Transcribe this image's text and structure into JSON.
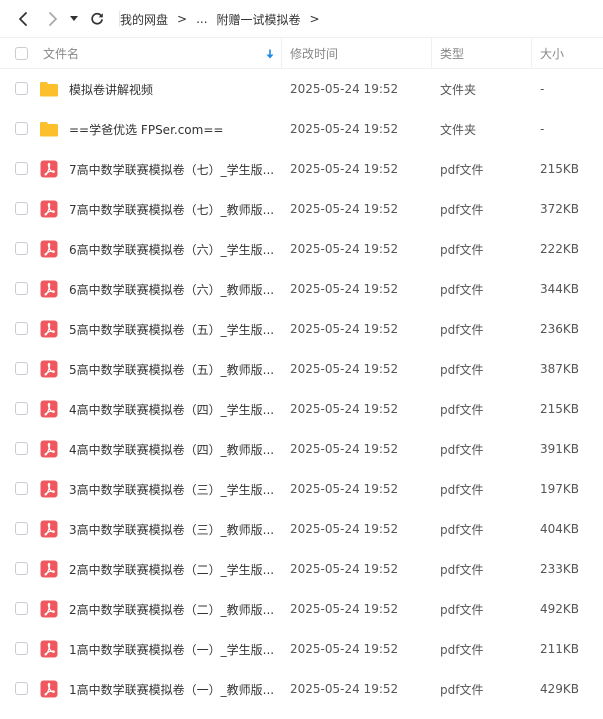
{
  "breadcrumb": {
    "root": "我的网盘",
    "sep1": ">",
    "ellipsis": "...",
    "current": "附赠一试模拟卷",
    "sep2": ">"
  },
  "columns": {
    "name": "文件名",
    "modified": "修改时间",
    "type": "类型",
    "size": "大小"
  },
  "sort_icon": "arrow-down-icon",
  "colors": {
    "folder": "#FBC02D",
    "pdf": "#F0585F",
    "sort_arrow": "#1E88E5"
  },
  "files": [
    {
      "name": "模拟卷讲解视频",
      "modified": "2025-05-24 19:52",
      "type": "文件夹",
      "size": "-",
      "icon": "folder-icon"
    },
    {
      "name": "==学爸优选 FPSer.com==",
      "modified": "2025-05-24 19:52",
      "type": "文件夹",
      "size": "-",
      "icon": "folder-icon"
    },
    {
      "name": "7高中数学联赛模拟卷（七）_学生版...",
      "modified": "2025-05-24 19:52",
      "type": "pdf文件",
      "size": "215KB",
      "icon": "pdf-icon"
    },
    {
      "name": "7高中数学联赛模拟卷（七）_教师版...",
      "modified": "2025-05-24 19:52",
      "type": "pdf文件",
      "size": "372KB",
      "icon": "pdf-icon"
    },
    {
      "name": "6高中数学联赛模拟卷（六）_学生版...",
      "modified": "2025-05-24 19:52",
      "type": "pdf文件",
      "size": "222KB",
      "icon": "pdf-icon"
    },
    {
      "name": "6高中数学联赛模拟卷（六）_教师版...",
      "modified": "2025-05-24 19:52",
      "type": "pdf文件",
      "size": "344KB",
      "icon": "pdf-icon"
    },
    {
      "name": "5高中数学联赛模拟卷（五）_学生版...",
      "modified": "2025-05-24 19:52",
      "type": "pdf文件",
      "size": "236KB",
      "icon": "pdf-icon"
    },
    {
      "name": "5高中数学联赛模拟卷（五）_教师版...",
      "modified": "2025-05-24 19:52",
      "type": "pdf文件",
      "size": "387KB",
      "icon": "pdf-icon"
    },
    {
      "name": "4高中数学联赛模拟卷（四）_学生版...",
      "modified": "2025-05-24 19:52",
      "type": "pdf文件",
      "size": "215KB",
      "icon": "pdf-icon"
    },
    {
      "name": "4高中数学联赛模拟卷（四）_教师版...",
      "modified": "2025-05-24 19:52",
      "type": "pdf文件",
      "size": "391KB",
      "icon": "pdf-icon"
    },
    {
      "name": "3高中数学联赛模拟卷（三）_学生版...",
      "modified": "2025-05-24 19:52",
      "type": "pdf文件",
      "size": "197KB",
      "icon": "pdf-icon"
    },
    {
      "name": "3高中数学联赛模拟卷（三）_教师版...",
      "modified": "2025-05-24 19:52",
      "type": "pdf文件",
      "size": "404KB",
      "icon": "pdf-icon"
    },
    {
      "name": "2高中数学联赛模拟卷（二）_学生版...",
      "modified": "2025-05-24 19:52",
      "type": "pdf文件",
      "size": "233KB",
      "icon": "pdf-icon"
    },
    {
      "name": "2高中数学联赛模拟卷（二）_教师版...",
      "modified": "2025-05-24 19:52",
      "type": "pdf文件",
      "size": "492KB",
      "icon": "pdf-icon"
    },
    {
      "name": "1高中数学联赛模拟卷（一）_学生版...",
      "modified": "2025-05-24 19:52",
      "type": "pdf文件",
      "size": "211KB",
      "icon": "pdf-icon"
    },
    {
      "name": "1高中数学联赛模拟卷（一）_教师版...",
      "modified": "2025-05-24 19:52",
      "type": "pdf文件",
      "size": "429KB",
      "icon": "pdf-icon"
    }
  ]
}
